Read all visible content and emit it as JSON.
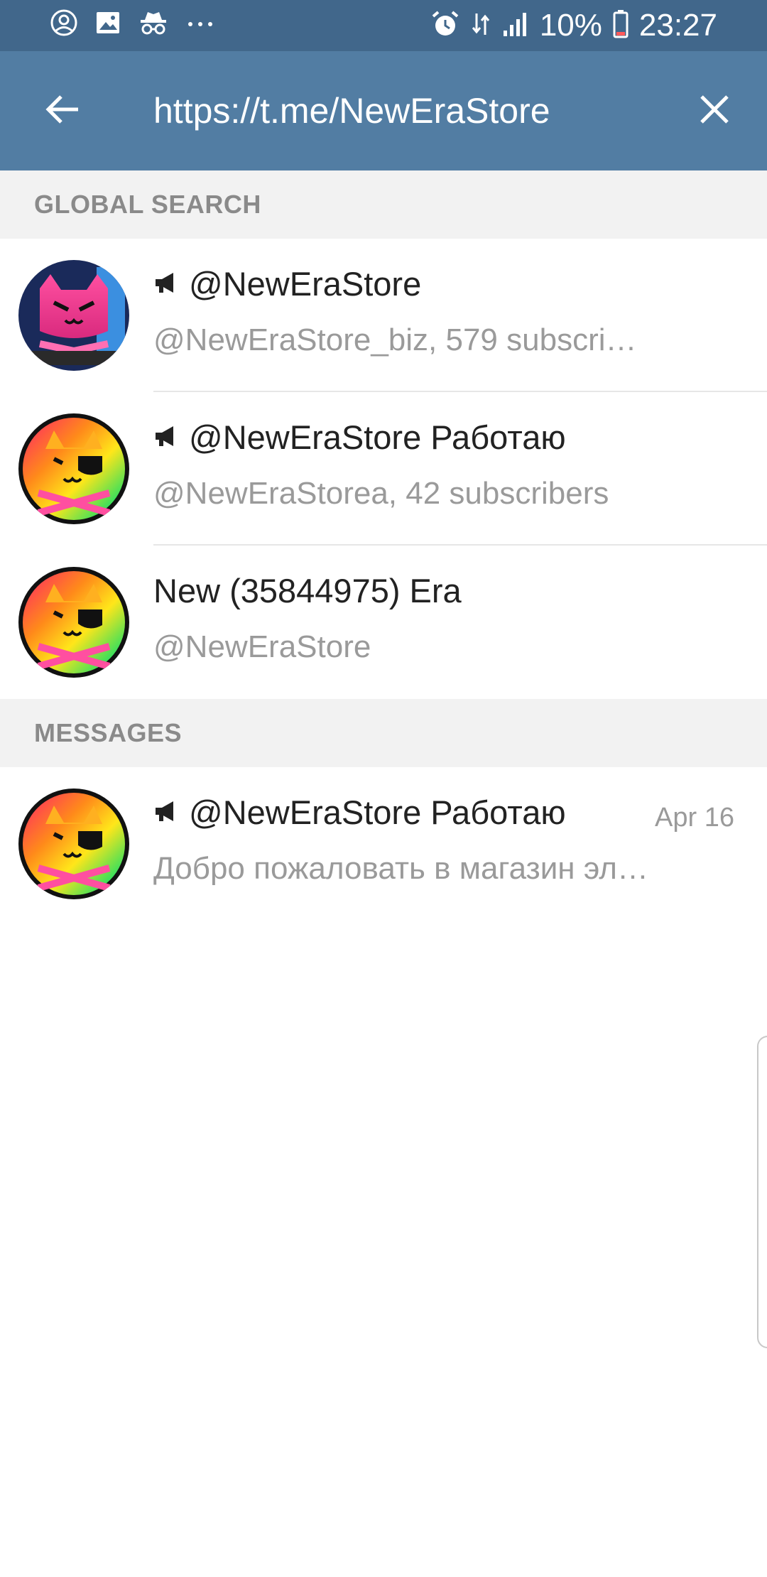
{
  "status_bar": {
    "icons": [
      "account-circle-icon",
      "image-icon",
      "incognito-icon",
      "more-dots-icon",
      "alarm-icon",
      "data-arrows-icon",
      "signal-icon",
      "battery-icon"
    ],
    "battery_percent": "10%",
    "time": "23:27"
  },
  "app_bar": {
    "back_icon": "arrow-left-icon",
    "search_value": "https://t.me/NewEraStore",
    "close_icon": "close-icon"
  },
  "sections": {
    "global_search_label": "GLOBAL SEARCH",
    "messages_label": "MESSAGES"
  },
  "global_results": [
    {
      "is_channel": true,
      "title": "@NewEraStore",
      "subtitle": "@NewEraStore_biz, 579 subscri…"
    },
    {
      "is_channel": true,
      "title": "@NewEraStore Работаю",
      "subtitle": "@NewEraStorea, 42 subscribers"
    },
    {
      "is_channel": false,
      "title": "New (35844975) Era",
      "subtitle": "@NewEraStore"
    }
  ],
  "messages": [
    {
      "is_channel": true,
      "title": "@NewEraStore Работаю",
      "date": "Apr 16",
      "preview": "Добро пожаловать в магазин эл…"
    }
  ],
  "colors": {
    "status_bar": "#41678b",
    "app_bar": "#527da3",
    "section_bg": "#f2f2f2",
    "section_text": "#8a8a8a",
    "title_text": "#222222",
    "subtitle_text": "#9a9a9a"
  }
}
